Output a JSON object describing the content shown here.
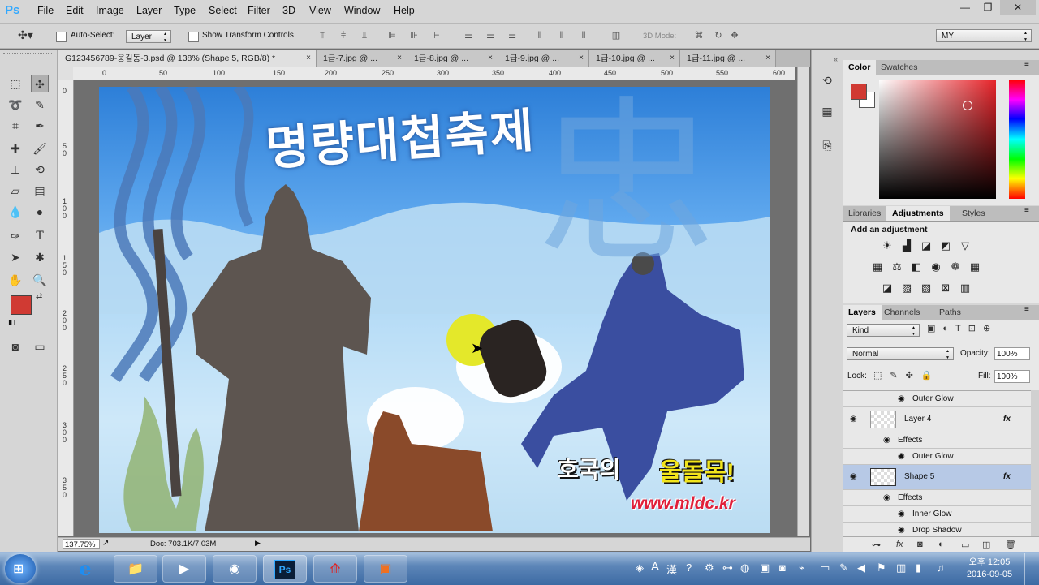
{
  "app": {
    "logo": "Ps"
  },
  "menu": [
    "File",
    "Edit",
    "Image",
    "Layer",
    "Type",
    "Select",
    "Filter",
    "3D",
    "View",
    "Window",
    "Help"
  ],
  "window_controls": {
    "minimize": "—",
    "restore": "❐",
    "close": "✕"
  },
  "options": {
    "auto_select_label": "Auto-Select:",
    "auto_select_value": "Layer",
    "show_transform_label": "Show Transform Controls",
    "mode_3d_label": "3D Mode:",
    "workspace_value": "MY"
  },
  "doc_tabs": [
    {
      "label": "G123456789-웅길동-3.psd @ 138% (Shape 5, RGB/8) *",
      "close": "×"
    },
    {
      "label": "1급-7.jpg @ ...",
      "close": "×"
    },
    {
      "label": "1급-8.jpg @ ...",
      "close": "×"
    },
    {
      "label": "1급-9.jpg @ ...",
      "close": "×"
    },
    {
      "label": "1급-10.jpg @ ...",
      "close": "×"
    },
    {
      "label": "1급-11.jpg @ ...",
      "close": "×"
    }
  ],
  "ruler_h": [
    "0",
    "50",
    "100",
    "150",
    "200",
    "250",
    "300",
    "350",
    "400",
    "450",
    "500",
    "550",
    "600"
  ],
  "ruler_v": [
    "0",
    "5\n0",
    "1\n0\n0",
    "1\n5\n0",
    "2\n0\n0",
    "2\n5\n0",
    "3\n0\n0",
    "3\n5\n0"
  ],
  "canvas": {
    "title_text": "명량대첩축제",
    "slogan_a": "호국의",
    "slogan_b": "울돌목!",
    "url_text": "www.mldc.kr",
    "bg_char": "忠"
  },
  "status": {
    "zoom": "137.75%",
    "doc": "Doc: 703.1K/7.03M"
  },
  "color_panel": {
    "tabs": [
      "Color",
      "Swatches"
    ],
    "foreground": "#d03a33",
    "background": "#ffffff",
    "hue_color": "#e8242a"
  },
  "adjust_panel": {
    "tabs": [
      "Libraries",
      "Adjustments",
      "Styles"
    ],
    "heading": "Add an adjustment"
  },
  "layers_panel": {
    "tabs": [
      "Layers",
      "Channels",
      "Paths"
    ],
    "kind_label": "Kind",
    "blend_mode": "Normal",
    "opacity_label": "Opacity:",
    "opacity_value": "100%",
    "lock_label": "Lock:",
    "fill_label": "Fill:",
    "fill_value": "100%",
    "rows": [
      {
        "type": "effect",
        "label": "Outer Glow"
      },
      {
        "type": "layer",
        "label": "Layer 4",
        "fx": "fx"
      },
      {
        "type": "effects-head",
        "label": "Effects"
      },
      {
        "type": "effect",
        "label": "Outer Glow"
      },
      {
        "type": "layer",
        "label": "Shape 5",
        "fx": "fx",
        "selected": true
      },
      {
        "type": "effects-head",
        "label": "Effects"
      },
      {
        "type": "effect",
        "label": "Inner Glow"
      },
      {
        "type": "effect",
        "label": "Drop Shadow"
      }
    ]
  },
  "taskbar": {
    "clock_time": "오후 12:05",
    "clock_date": "2016-09-05",
    "ime_a": "A",
    "ime_han": "漢"
  }
}
